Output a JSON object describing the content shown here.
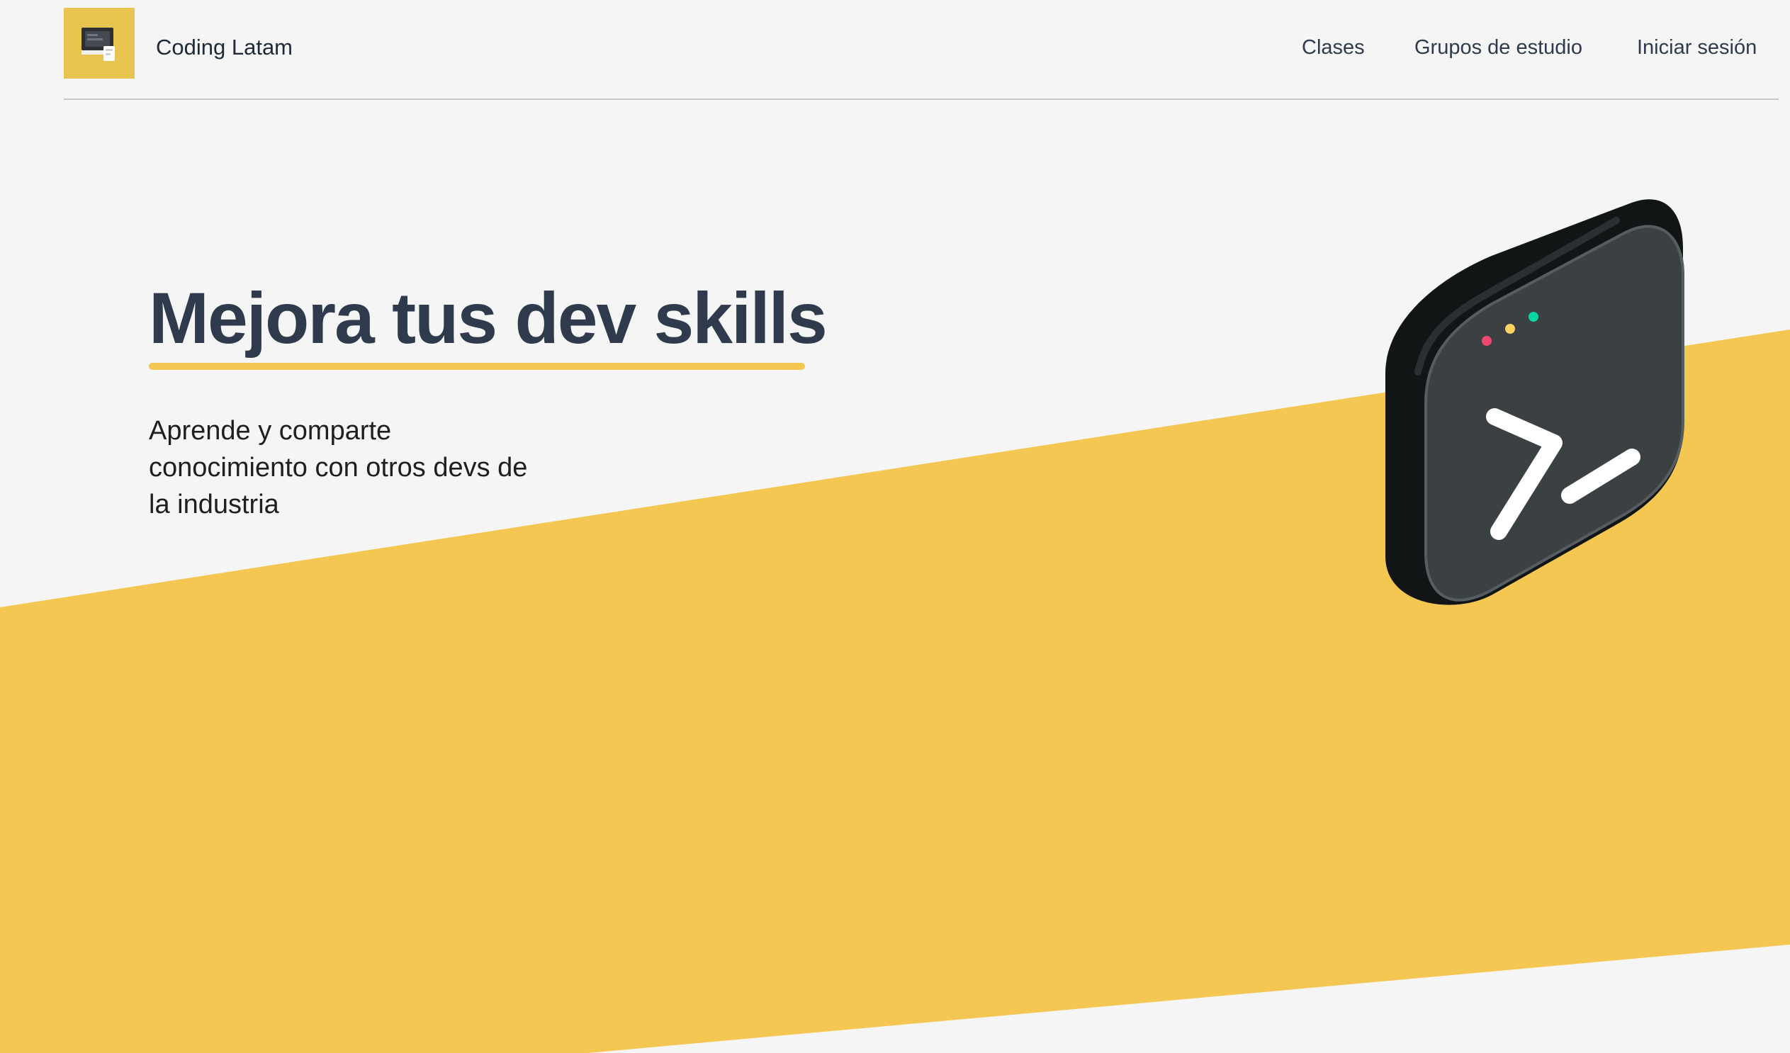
{
  "header": {
    "brand_name": "Coding Latam",
    "logo_icon": "computer-icon",
    "nav": [
      {
        "label": "Clases"
      },
      {
        "label": "Grupos de estudio"
      },
      {
        "label": "Iniciar sesión"
      }
    ]
  },
  "hero": {
    "title": "Mejora tus dev skills",
    "subtitle": "Aprende y comparte conocimiento con otros devs de la industria",
    "illustration_icon": "terminal-icon"
  },
  "colors": {
    "accent": "#f3c751",
    "logo_background": "#e6c44f",
    "background": "#f5f5f5",
    "text_dark": "#2f3a4c",
    "terminal_face": "#3b4042",
    "terminal_side": "#111516",
    "window_dot_red": "#ef476f",
    "window_dot_yellow": "#ffd166",
    "window_dot_green": "#06d6a0"
  }
}
